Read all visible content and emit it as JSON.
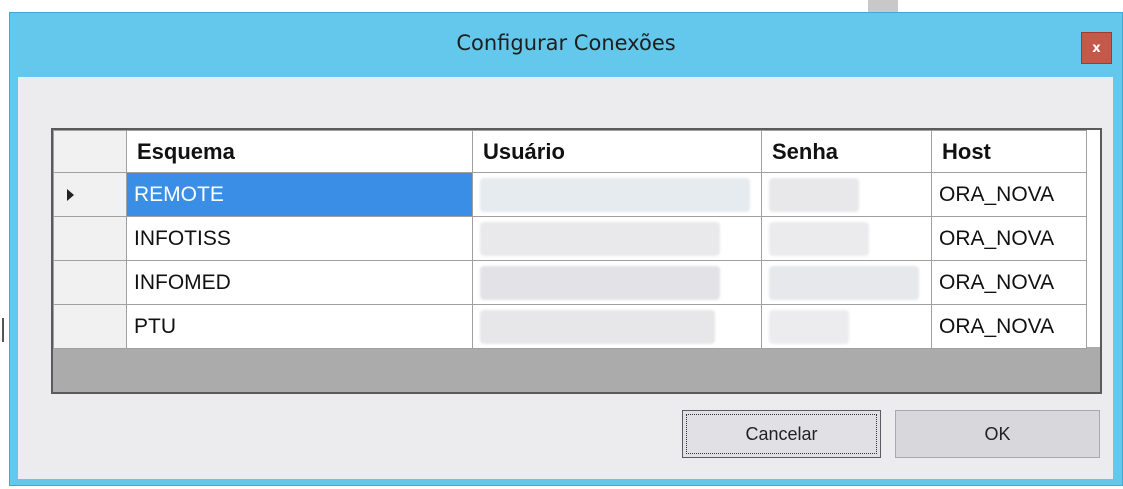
{
  "window": {
    "title": "Configurar Conexões",
    "close_label": "x"
  },
  "grid": {
    "columns": [
      "Esquema",
      "Usuário",
      "Senha",
      "Host"
    ],
    "rows": [
      {
        "esquema": "REMOTE",
        "usuario": "",
        "senha": "",
        "host": "ORA_NOVA",
        "selected": true
      },
      {
        "esquema": "INFOTISS",
        "usuario": "",
        "senha": "",
        "host": "ORA_NOVA",
        "selected": false
      },
      {
        "esquema": "INFOMED",
        "usuario": "",
        "senha": "",
        "host": "ORA_NOVA",
        "selected": false
      },
      {
        "esquema": "PTU",
        "usuario": "",
        "senha": "",
        "host": "ORA_NOVA",
        "selected": false
      }
    ],
    "current_row_indicator": "arrow-icon"
  },
  "buttons": {
    "cancel_label": "Cancelar",
    "ok_label": "OK"
  },
  "colors": {
    "titlebar": "#64c8ec",
    "close_button": "#c4584b",
    "selection": "#3a8ee6",
    "client_area": "#ececef"
  }
}
